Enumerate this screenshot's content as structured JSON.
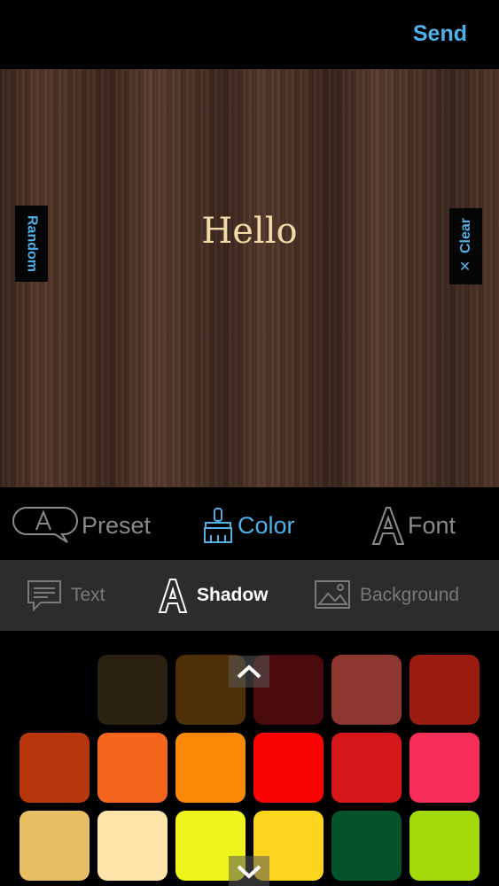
{
  "header": {
    "send_label": "Send"
  },
  "canvas": {
    "text": "Hello",
    "random_label": "Random",
    "clear_label": "✕ Clear"
  },
  "main_tabs": [
    {
      "label": "Preset",
      "icon": "preset-bubble-icon",
      "active": false
    },
    {
      "label": "Color",
      "icon": "brush-icon",
      "active": true
    },
    {
      "label": "Font",
      "icon": "font-a-icon",
      "active": false
    }
  ],
  "sub_tabs": [
    {
      "label": "Text",
      "icon": "speech-bubble-icon",
      "active": false
    },
    {
      "label": "Shadow",
      "icon": "outline-a-icon",
      "active": true
    },
    {
      "label": "Background",
      "icon": "image-icon",
      "active": false
    }
  ],
  "swatches": [
    [
      "#2a2112",
      "#4d3008",
      "#4a0a0e",
      "#8e3630",
      "#9a1c10"
    ],
    [
      "#b8360e",
      "#f5651e",
      "#f98906",
      "#fa0303",
      "#d5171a",
      "#f82e5a"
    ],
    [
      "#e7be62",
      "#fde4a8",
      "#eff41c",
      "#fad41d",
      "#05532a",
      "#a3d80b"
    ]
  ],
  "colors": {
    "accent": "#4fb0e8",
    "inactive": "#8a8a8a",
    "sub_bar": "#2c2c2c",
    "canvas_text": "#f3d9a8"
  }
}
